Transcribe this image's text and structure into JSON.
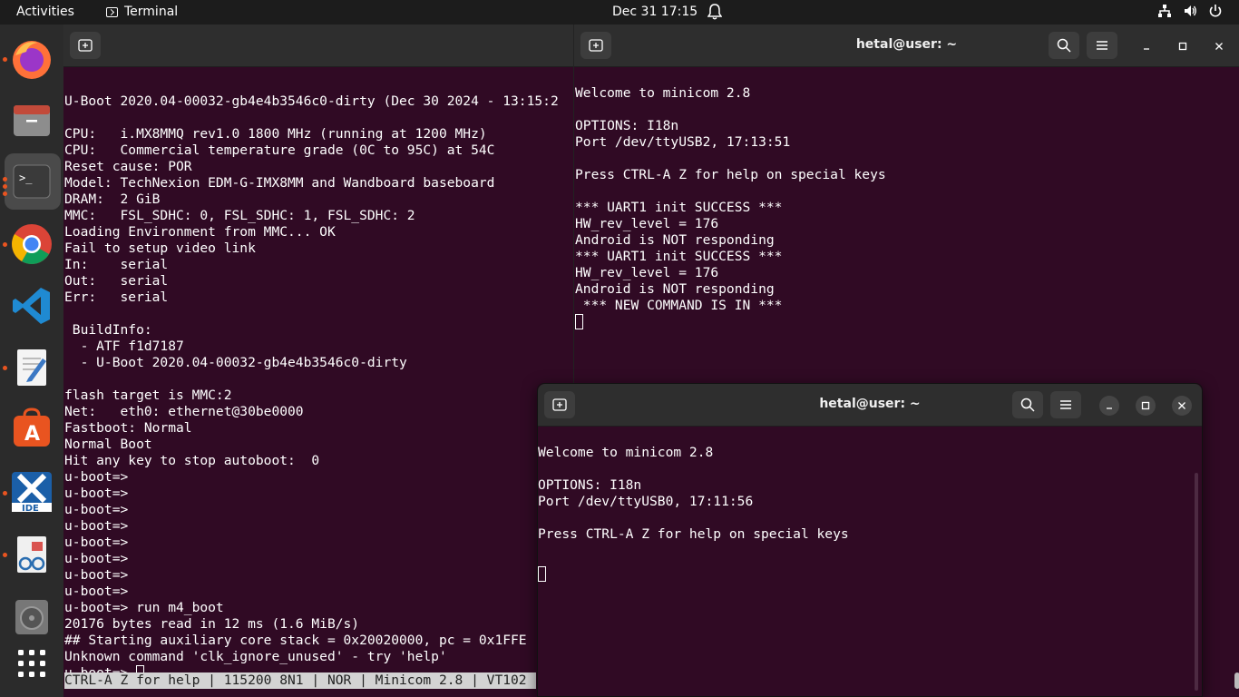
{
  "topbar": {
    "activities": "Activities",
    "app_name": "Terminal",
    "clock": "Dec 31  17:15"
  },
  "dock": {
    "items": [
      "firefox-icon",
      "files-icon",
      "terminal-icon",
      "chrome-icon",
      "vscode-icon",
      "text-editor-icon",
      "app-center-icon",
      "stm32-ide-icon",
      "document-viewer-icon",
      "disk-icon",
      "show-apps-icon"
    ]
  },
  "left_terminal": {
    "lines": [
      "",
      "U-Boot 2020.04-00032-gb4e4b3546c0-dirty (Dec 30 2024 - 13:15:2",
      "",
      "CPU:   i.MX8MMQ rev1.0 1800 MHz (running at 1200 MHz)",
      "CPU:   Commercial temperature grade (0C to 95C) at 54C",
      "Reset cause: POR",
      "Model: TechNexion EDM-G-IMX8MM and Wandboard baseboard",
      "DRAM:  2 GiB",
      "MMC:   FSL_SDHC: 0, FSL_SDHC: 1, FSL_SDHC: 2",
      "Loading Environment from MMC... OK",
      "Fail to setup video link",
      "In:    serial",
      "Out:   serial",
      "Err:   serial",
      "",
      " BuildInfo:",
      "  - ATF f1d7187",
      "  - U-Boot 2020.04-00032-gb4e4b3546c0-dirty",
      "",
      "flash target is MMC:2",
      "Net:   eth0: ethernet@30be0000",
      "Fastboot: Normal",
      "Normal Boot",
      "Hit any key to stop autoboot:  0",
      "u-boot=>",
      "u-boot=>",
      "u-boot=>",
      "u-boot=>",
      "u-boot=>",
      "u-boot=>",
      "u-boot=>",
      "u-boot=>",
      "u-boot=> run m4_boot",
      "20176 bytes read in 12 ms (1.6 MiB/s)",
      "## Starting auxiliary core stack = 0x20020000, pc = 0x1FFE",
      "Unknown command 'clk_ignore_unused' - try 'help'"
    ],
    "prompt": "u-boot=> ",
    "status": "CTRL-A Z for help | 115200 8N1 | NOR | Minicom 2.8 | VT102"
  },
  "right_terminal": {
    "title": "hetal@user: ~",
    "lines": [
      "Welcome to minicom 2.8",
      "",
      "OPTIONS: I18n",
      "Port /dev/ttyUSB2, 17:13:51",
      "",
      "Press CTRL-A Z for help on special keys",
      "",
      "*** UART1 init SUCCESS ***",
      "HW_rev_level = 176",
      "Android is NOT responding",
      "*** UART1 init SUCCESS ***",
      "HW_rev_level = 176",
      "Android is NOT responding",
      " *** NEW COMMAND IS IN ***"
    ]
  },
  "front_terminal": {
    "title": "hetal@user: ~",
    "lines": [
      "Welcome to minicom 2.8",
      "",
      "OPTIONS: I18n",
      "Port /dev/ttyUSB0, 17:11:56",
      "",
      "Press CTRL-A Z for help on special keys",
      ""
    ]
  }
}
